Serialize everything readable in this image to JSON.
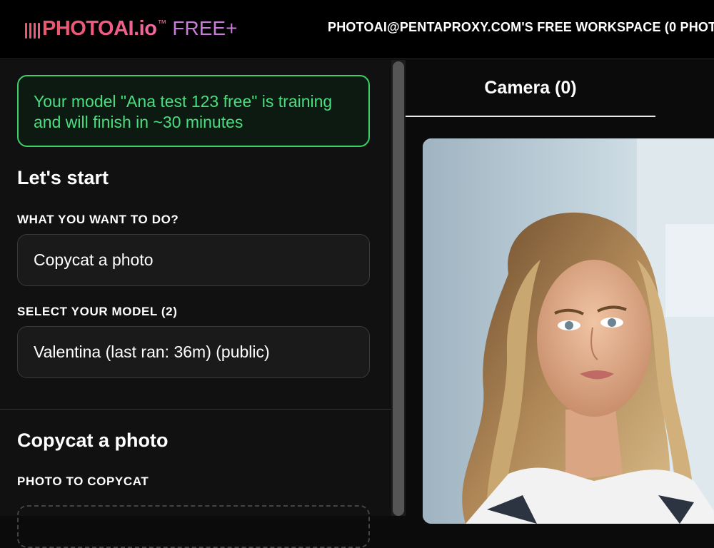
{
  "header": {
    "logo_brand": "PHOTOAI.io",
    "logo_tm": "™",
    "logo_plan": "FREE+",
    "workspace": "PHOTOAI@PENTAPROXY.COM'S FREE WORKSPACE (0 PHOT"
  },
  "alert": {
    "message": "Your model \"Ana test 123 free\" is training and will finish in ~30 minutes"
  },
  "start": {
    "title": "Let's start",
    "action_label": "WHAT YOU WANT TO DO?",
    "action_value": "Copycat a photo",
    "model_label": "SELECT YOUR MODEL (2)",
    "model_value": "Valentina (last ran: 36m) (public)"
  },
  "copycat": {
    "title": "Copycat a photo",
    "photo_label": "PHOTO TO COPYCAT"
  },
  "right": {
    "tab_label": "Camera (0)"
  },
  "colors": {
    "accent_green": "#4ade80",
    "brand_pink": "#ef5a80",
    "brand_purple": "#c77dd6"
  }
}
